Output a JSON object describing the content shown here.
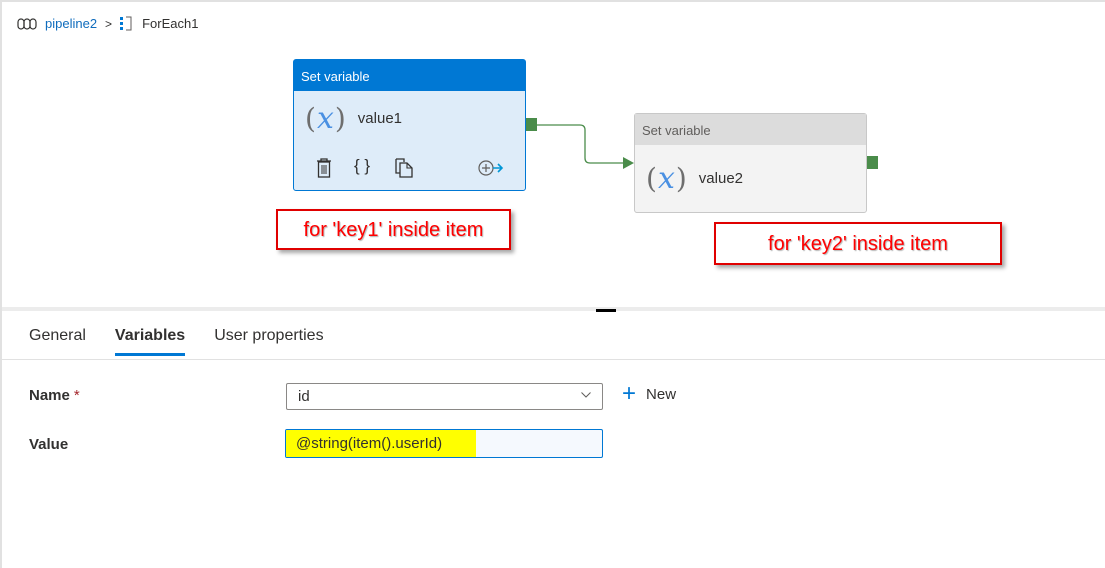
{
  "breadcrumb": {
    "pipeline_icon": "pipeline-icon",
    "pipeline": "pipeline2",
    "separator": ">",
    "foreach_icon": "foreach-icon",
    "current": "ForEach1"
  },
  "activities": [
    {
      "type": "Set variable",
      "name": "value1",
      "icon": "variable-icon",
      "selected": true,
      "tools": [
        "delete-icon",
        "code-icon",
        "copy-icon",
        "add-output-icon"
      ]
    },
    {
      "type": "Set variable",
      "name": "value2",
      "icon": "variable-icon",
      "selected": false
    }
  ],
  "annotations": [
    "for 'key1' inside item",
    "for 'key2' inside item"
  ],
  "tabs": [
    {
      "label": "General",
      "active": false
    },
    {
      "label": "Variables",
      "active": true
    },
    {
      "label": "User properties",
      "active": false
    }
  ],
  "form": {
    "name_label": "Name",
    "required_mark": "*",
    "name_value": "id",
    "new_label": "New",
    "value_label": "Value",
    "value_value": "@string(item().userId)"
  },
  "colors": {
    "accent": "#0078d4",
    "success_connector": "#4a8c4a",
    "annotation": "#ff0000",
    "highlight": "#ffff00"
  }
}
